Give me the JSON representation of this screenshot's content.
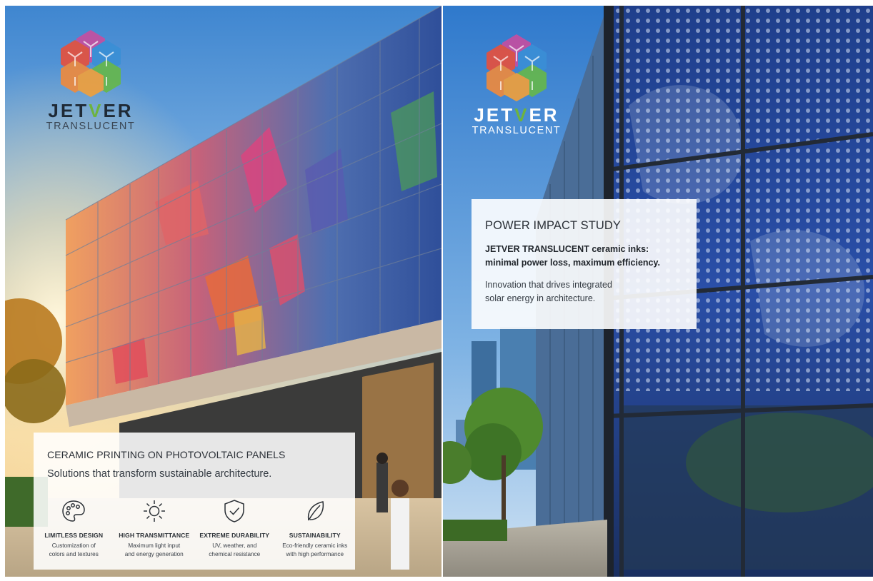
{
  "colors": {
    "brand_green": "#6db33f",
    "logo_cube_colors": [
      "#e04e8a",
      "#3a8fd6",
      "#f08a3c",
      "#66b84a",
      "#e8503c",
      "#f2a03a"
    ],
    "card_background": "#ffffff",
    "sky": "#4f93d6"
  },
  "left_panel": {
    "logo": {
      "wordmark_pre": "JET",
      "wordmark_v": "V",
      "wordmark_post": "ER",
      "tagline": "TRANSLUCENT"
    },
    "card": {
      "title": "CERAMIC PRINTING ON PHOTOVOLTAIC PANELS",
      "subtitle": "Solutions that transform sustainable architecture.",
      "features": [
        {
          "icon": "palette-icon",
          "title": "LIMITLESS DESIGN",
          "description": "Customization of\ncolors and textures"
        },
        {
          "icon": "sun-icon",
          "title": "HIGH TRANSMITTANCE",
          "description": "Maximum light input\nand energy generation"
        },
        {
          "icon": "shield-check-icon",
          "title": "EXTREME DURABILITY",
          "description": "UV, weather, and\nchemical resistance"
        },
        {
          "icon": "leaf-icon",
          "title": "SUSTAINABILITY",
          "description": "Eco-friendly ceramic inks\nwith high performance"
        }
      ]
    }
  },
  "right_panel": {
    "logo": {
      "wordmark_pre": "JET",
      "wordmark_v": "V",
      "wordmark_post": "ER",
      "tagline": "TRANSLUCENT"
    },
    "card": {
      "title": "POWER IMPACT STUDY",
      "highlight": "JETVER TRANSLUCENT ceramic inks:\nminimal power loss, maximum efficiency.",
      "body": "Innovation that drives integrated\nsolar energy in architecture."
    }
  }
}
